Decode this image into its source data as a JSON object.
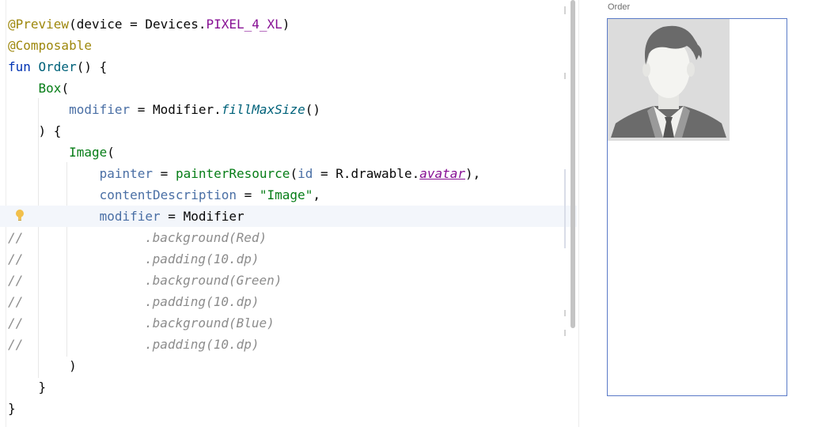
{
  "editor": {
    "lines": [
      {
        "t": [
          [
            "@Preview",
            "ann"
          ],
          [
            "(device = Devices.",
            "plain"
          ],
          [
            "PIXEL_4_XL",
            "const"
          ],
          [
            ")",
            "plain"
          ]
        ]
      },
      {
        "t": [
          [
            "@Composable",
            "ann"
          ]
        ]
      },
      {
        "t": [
          [
            "fun ",
            "kw"
          ],
          [
            "Order",
            "fn"
          ],
          [
            "() {",
            "plain"
          ]
        ]
      },
      {
        "t": [
          [
            "    ",
            "plain"
          ],
          [
            "Box",
            "call"
          ],
          [
            "(",
            "plain"
          ]
        ]
      },
      {
        "t": [
          [
            "        ",
            "plain"
          ],
          [
            "modifier",
            "param"
          ],
          [
            " = ",
            "plain"
          ],
          [
            "Modifier.",
            "plain"
          ],
          [
            "fillMaxSize",
            "ext"
          ],
          [
            "()",
            "plain"
          ]
        ]
      },
      {
        "t": [
          [
            "    ) {",
            "plain"
          ]
        ]
      },
      {
        "t": [
          [
            "        ",
            "plain"
          ],
          [
            "Image",
            "call"
          ],
          [
            "(",
            "plain"
          ]
        ]
      },
      {
        "t": [
          [
            "            ",
            "plain"
          ],
          [
            "painter",
            "param"
          ],
          [
            " = ",
            "plain"
          ],
          [
            "painterResource",
            "call"
          ],
          [
            "(",
            "plain"
          ],
          [
            "id",
            "param"
          ],
          [
            " = R.drawable.",
            "plain"
          ],
          [
            "avatar",
            "ref"
          ],
          [
            "),",
            "plain"
          ]
        ]
      },
      {
        "t": [
          [
            "            ",
            "plain"
          ],
          [
            "contentDescription",
            "param"
          ],
          [
            " = ",
            "plain"
          ],
          [
            "\"Image\"",
            "str"
          ],
          [
            ",",
            "plain"
          ]
        ]
      },
      {
        "t": [
          [
            "            ",
            "plain"
          ],
          [
            "modifier",
            "param"
          ],
          [
            " = ",
            "plain"
          ],
          [
            "Modifier",
            "plain"
          ]
        ]
      },
      {
        "c": ".background(Red)"
      },
      {
        "c": ".padding(10.dp)"
      },
      {
        "c": ".background(Green)"
      },
      {
        "c": ".padding(10.dp)"
      },
      {
        "c": ".background(Blue)"
      },
      {
        "c": ".padding(10.dp)"
      },
      {
        "t": [
          [
            "        )",
            "plain"
          ]
        ]
      },
      {
        "t": [
          [
            "    }",
            "plain"
          ]
        ]
      },
      {
        "t": [
          [
            "}",
            "plain"
          ]
        ]
      }
    ],
    "comment_prefix": "//",
    "highlighted_line": 10,
    "gutter_icon": "lightbulb-icon"
  },
  "preview": {
    "title": "Order",
    "image_description": "avatar",
    "frame_color": "#5a7ac7"
  },
  "colors": {
    "annotation": "#9e880d",
    "keyword": "#0033b3",
    "function": "#00627a",
    "call": "#067d17",
    "param": "#4a6fa5",
    "constant": "#871094",
    "comment": "#8c8c8c"
  }
}
